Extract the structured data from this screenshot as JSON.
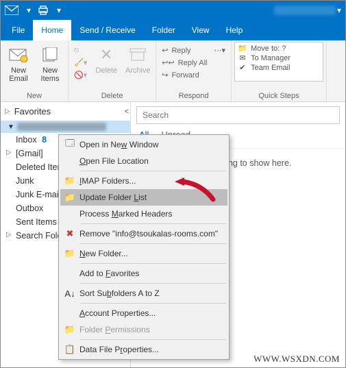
{
  "titlebar": {
    "account_blur": "blurred account name"
  },
  "menubar": {
    "tabs": {
      "file": "File",
      "home": "Home",
      "send_receive": "Send / Receive",
      "folder": "Folder",
      "view": "View",
      "help": "Help"
    }
  },
  "ribbon": {
    "new_group_label": "New",
    "new_email": "New\nEmail",
    "new_items": "New\nItems",
    "delete_group_label": "Delete",
    "delete_btn": "Delete",
    "archive_btn": "Archive",
    "respond_group_label": "Respond",
    "reply": "Reply",
    "reply_all": "Reply All",
    "forward": "Forward",
    "quick_steps_label": "Quick Steps",
    "move_to": "Move to: ?",
    "to_manager": "To Manager",
    "team_email": "Team Email"
  },
  "nav": {
    "favorites": "Favorites",
    "items": {
      "inbox": "Inbox",
      "inbox_count": "8",
      "gmail": "[Gmail]",
      "deleted": "Deleted Items",
      "junk": "Junk",
      "junk_email": "Junk E-mail",
      "outbox": "Outbox",
      "sent": "Sent Items",
      "search_folders": "Search Folders"
    }
  },
  "msgarea": {
    "search_placeholder": "Search",
    "filter_all": "All",
    "filter_unread": "Unread",
    "empty_msg": "We didn't find anything to show here."
  },
  "contextmenu": {
    "open_new_window": "Open in New Window",
    "open_file_location": "Open File Location",
    "imap_folders": "IMAP Folders...",
    "update_folder_list": "Update Folder List",
    "process_marked_headers": "Process Marked Headers",
    "remove": "Remove \"info@tsoukalas-rooms.com\"",
    "new_folder": "New Folder...",
    "add_to_favorites": "Add to Favorites",
    "sort_subfolders": "Sort Subfolders A to Z",
    "account_properties": "Account Properties...",
    "folder_permissions": "Folder Permissions",
    "data_file_properties": "Data File Properties..."
  },
  "watermark": "WWW.WSXDN.COM"
}
